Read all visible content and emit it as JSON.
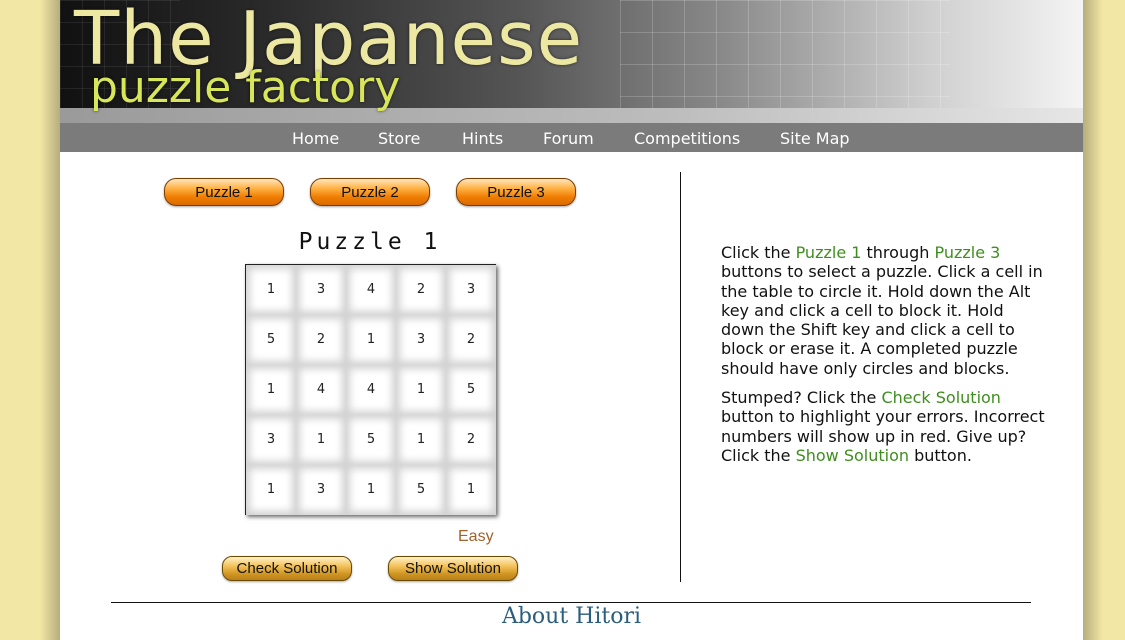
{
  "header": {
    "logo_line1": "The Japanese",
    "logo_line2": "puzzle factory"
  },
  "nav": {
    "items": [
      "Home",
      "Store",
      "Hints",
      "Forum",
      "Competitions",
      "Site Map"
    ]
  },
  "puzzle_buttons": [
    "Puzzle 1",
    "Puzzle 2",
    "Puzzle 3"
  ],
  "puzzle": {
    "title": "Puzzle 1",
    "difficulty": "Easy",
    "rows": [
      [
        "1",
        "3",
        "4",
        "2",
        "3"
      ],
      [
        "5",
        "2",
        "1",
        "3",
        "2"
      ],
      [
        "1",
        "4",
        "4",
        "1",
        "5"
      ],
      [
        "3",
        "1",
        "5",
        "1",
        "2"
      ],
      [
        "1",
        "3",
        "1",
        "5",
        "1"
      ]
    ]
  },
  "actions": {
    "check_label": "Check Solution",
    "show_label": "Show Solution"
  },
  "instructions": {
    "p1_a": "Click the ",
    "p1_link1": "Puzzle 1",
    "p1_b": " through ",
    "p1_link2": "Puzzle 3",
    "p1_c": " buttons to select a puzzle. Click a cell in the table to circle it. Hold down the Alt key and click a cell to block it. Hold down the Shift key and click a cell to block or erase it. A completed puzzle should have only circles and blocks.",
    "p2_a": "Stumped? Click the ",
    "p2_link1": "Check Solution",
    "p2_b": " button to highlight your errors. Incorrect numbers will show up in red. Give up? Click the ",
    "p2_link2": "Show Solution",
    "p2_c": " button."
  },
  "about_heading": "About Hitori",
  "colors": {
    "page_bg": "#f3e7a6",
    "nav_bg": "#7b7b7b",
    "highlight_text": "#3e8e1f",
    "difficulty_text": "#a0622a",
    "about_heading": "#2b5e7e"
  }
}
